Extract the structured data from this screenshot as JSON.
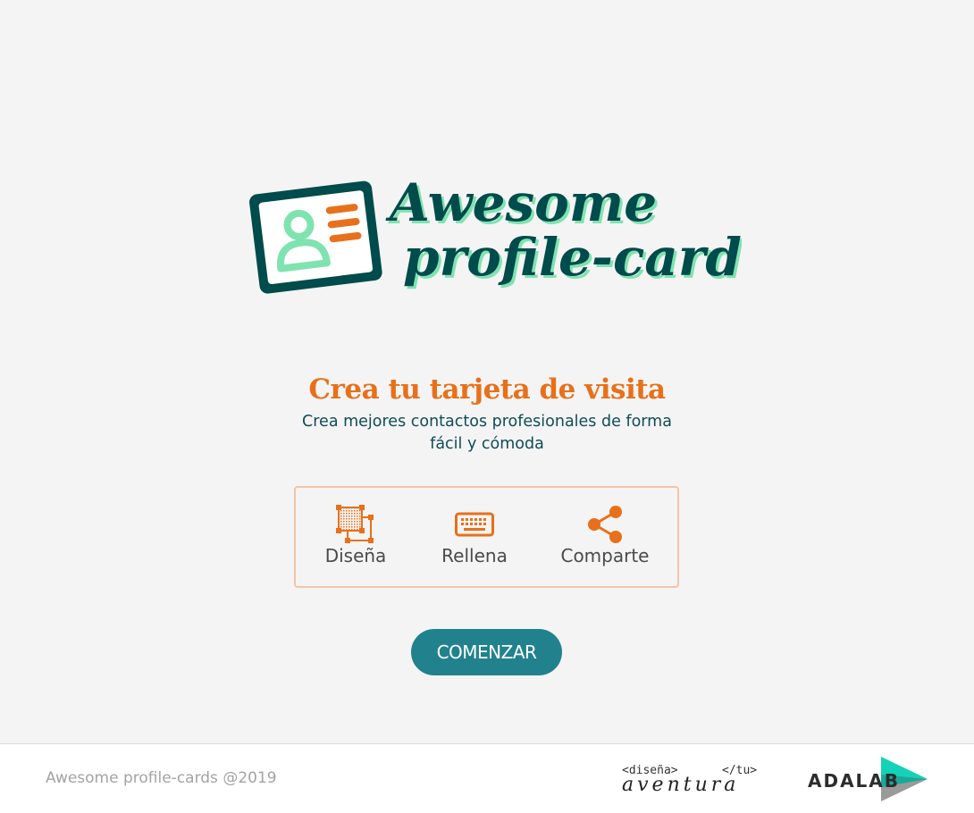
{
  "header": {
    "logo": {
      "line1": "Awesome",
      "line2": "profile-cards",
      "icon": "id-card-icon"
    }
  },
  "hero": {
    "title": "Crea tu tarjeta de visita",
    "subtitle": "Crea mejores contactos profesionales de forma fácil y cómoda"
  },
  "steps": [
    {
      "label": "Diseña",
      "icon": "design-grid-icon"
    },
    {
      "label": "Rellena",
      "icon": "keyboard-icon"
    },
    {
      "label": "Comparte",
      "icon": "share-icon"
    }
  ],
  "cta": {
    "label": "COMENZAR"
  },
  "footer": {
    "copyright": "Awesome profile-cards @2019",
    "tu_logo": {
      "open_tag": "<diseña>",
      "close_tag": "</tu>",
      "word": "aventura"
    },
    "adalab_logo": {
      "text": "ADALAB"
    }
  },
  "colors": {
    "accent_orange": "#e8701a",
    "dark_teal": "#004b4b",
    "mint": "#7fe3b0",
    "button_teal": "#21828d",
    "background": "#f4f4f4"
  }
}
